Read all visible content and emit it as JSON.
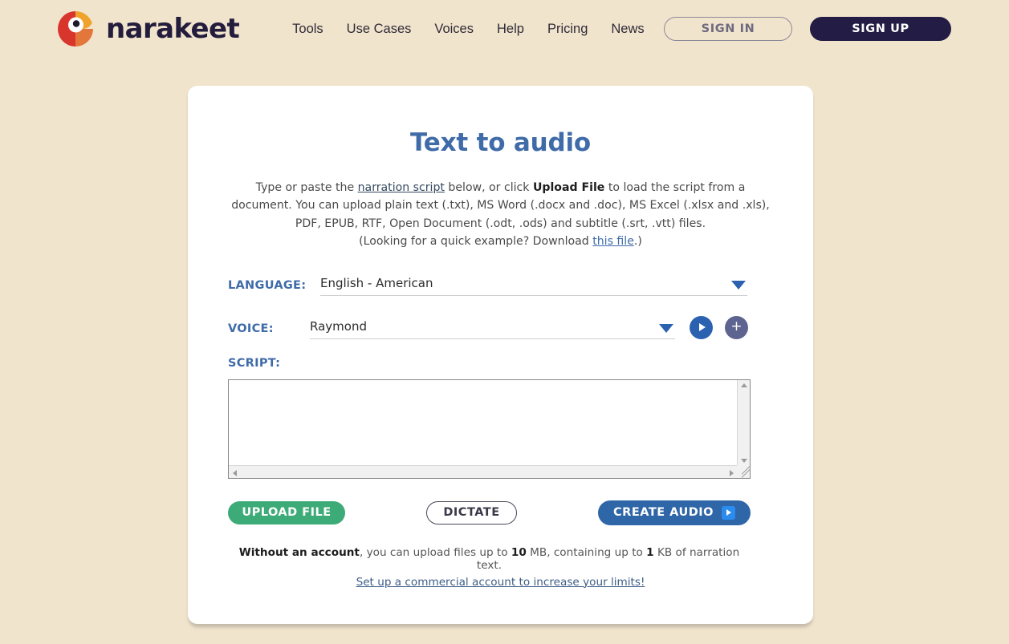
{
  "header": {
    "brand_name": "narakeet",
    "logo_colors": {
      "red": "#d8352c",
      "orange": "#f0a32a",
      "amber": "#e2763b",
      "pupil": "#1b1b2a"
    },
    "nav": [
      {
        "label": "Tools"
      },
      {
        "label": "Use Cases"
      },
      {
        "label": "Voices"
      },
      {
        "label": "Help"
      },
      {
        "label": "Pricing"
      },
      {
        "label": "News"
      }
    ],
    "sign_in_label": "SIGN IN",
    "sign_up_label": "SIGN UP"
  },
  "card": {
    "title": "Text to audio",
    "intro": {
      "p1_a": "Type or paste the ",
      "p1_link": "narration script",
      "p1_b": " below, or click ",
      "p1_bold": "Upload File",
      "p1_c": " to load the script from a document. You can upload plain text (.txt), MS Word (.docx and .doc), MS Excel (.xlsx and .xls), PDF, EPUB, RTF, Open Document (.odt, .ods) and subtitle (.srt, .vtt) files.",
      "p2_a": "(Looking for a quick example? Download ",
      "p2_link": "this file",
      "p2_b": ".)"
    },
    "language": {
      "label": "LANGUAGE:",
      "value": "English - American"
    },
    "voice": {
      "label": "VOICE:",
      "value": "Raymond",
      "preview_icon": "play-icon",
      "add_icon": "plus-icon"
    },
    "script": {
      "label": "SCRIPT:",
      "value": "",
      "placeholder": ""
    },
    "actions": {
      "upload_label": "UPLOAD FILE",
      "dictate_label": "DICTATE",
      "create_label": "CREATE AUDIO",
      "create_icon": "play-icon"
    },
    "limits": {
      "bold_prefix": "Without an account",
      "text_a": ", you can upload files up to ",
      "size_value": "10",
      "text_b": " MB, containing up to ",
      "text_value": "1",
      "text_c": " KB of narration text.",
      "link": "Set up a commercial account to increase your limits!"
    }
  },
  "colors": {
    "page_background": "#f1e4cd",
    "card_background": "#ffffff",
    "accent_blue": "#3f6ba8",
    "accent_green": "#3dab77",
    "accent_navy": "#231c44"
  }
}
